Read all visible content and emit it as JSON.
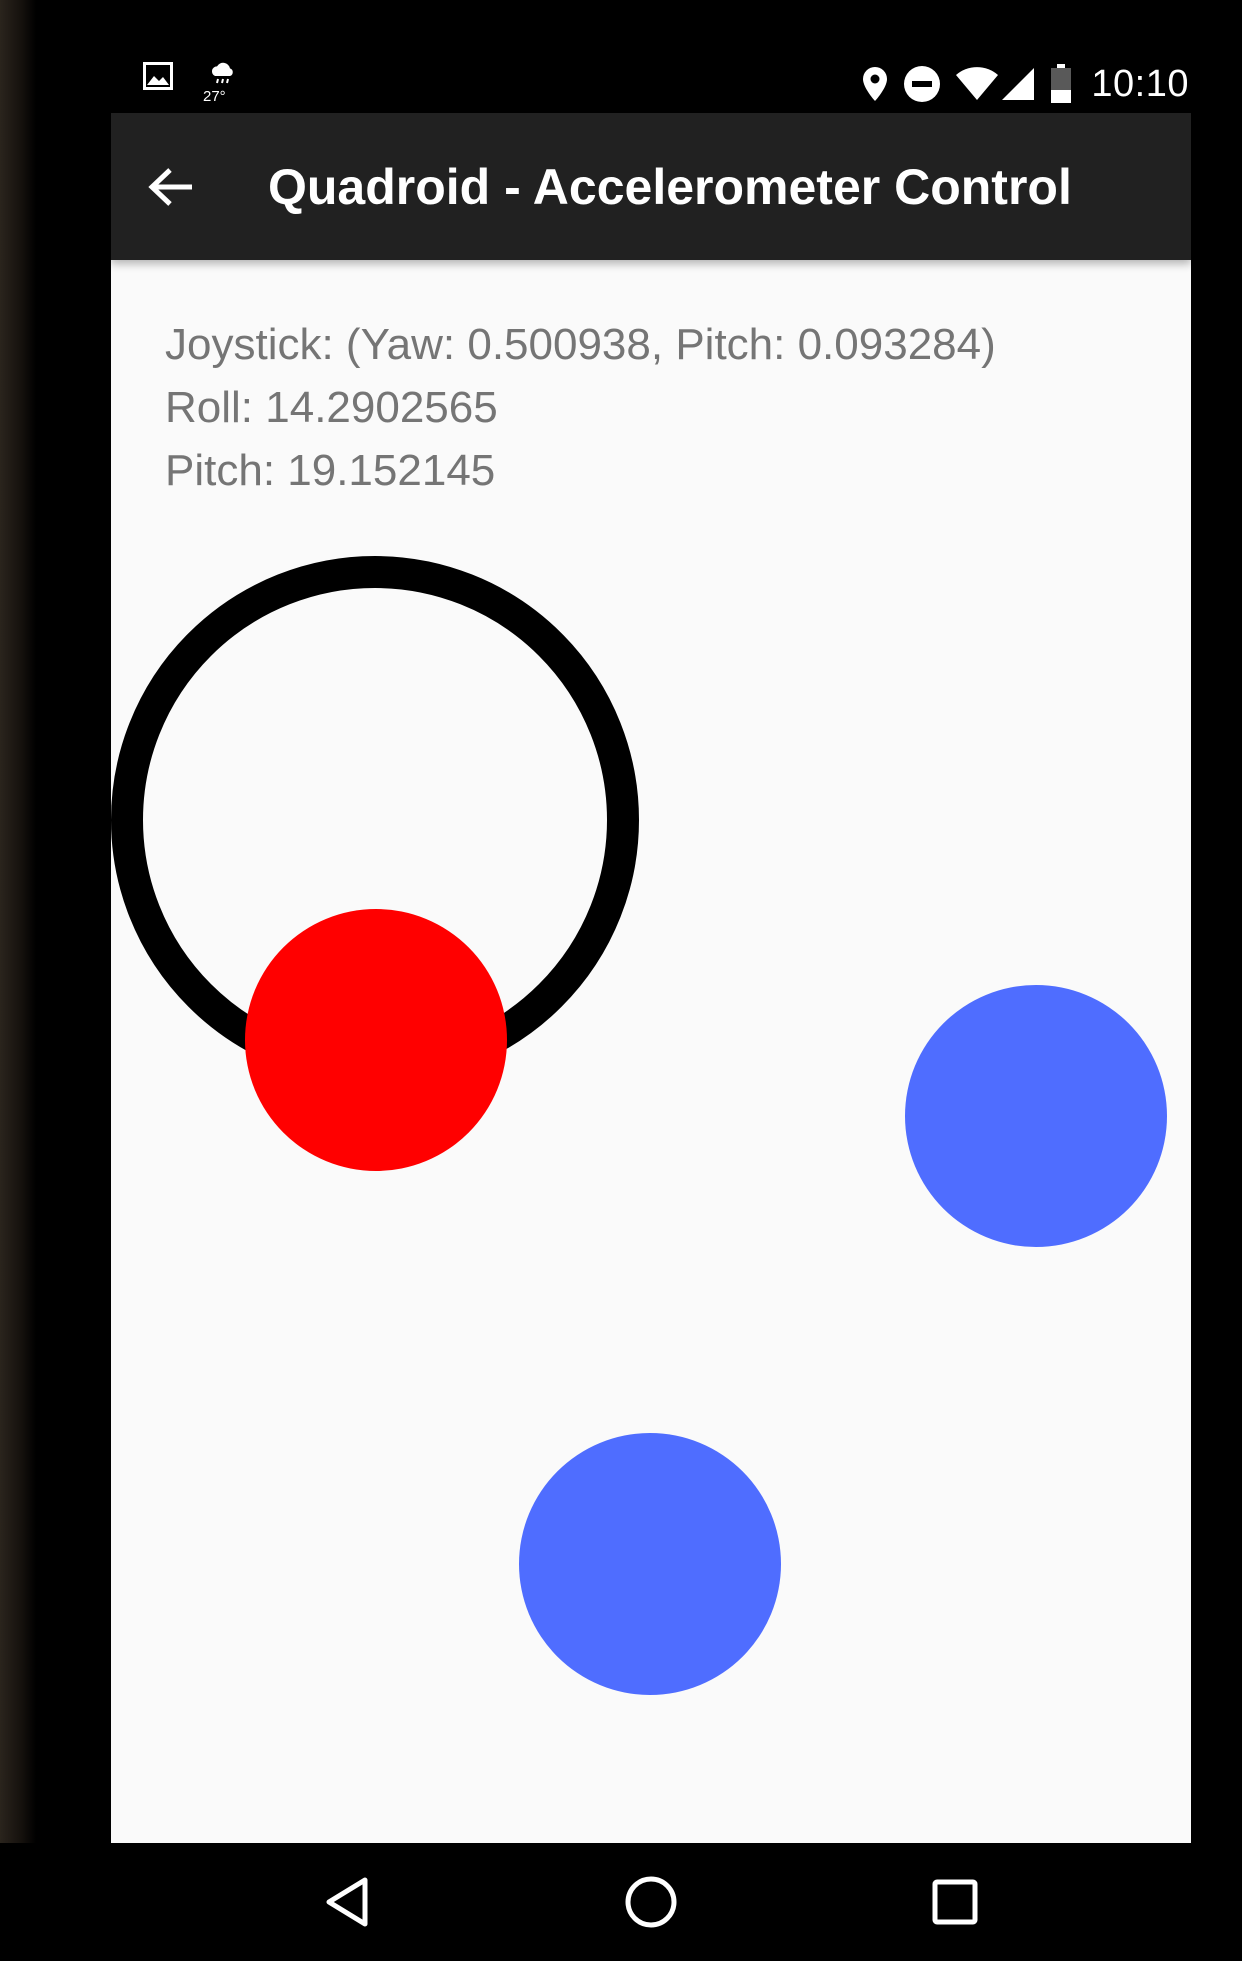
{
  "status_bar": {
    "time": "10:10",
    "weather_temp": "27°",
    "left_icons": [
      "image-icon",
      "weather-icon"
    ],
    "right_icons": [
      "location-icon",
      "do-not-disturb-icon",
      "wifi-icon",
      "cell-signal-icon",
      "battery-icon"
    ]
  },
  "toolbar": {
    "title": "Quadroid - Accelerometer Control",
    "back_icon": "arrow-back-icon"
  },
  "readouts": {
    "joystick": "Joystick: (Yaw: 0.500938, Pitch: 0.093284)",
    "roll": "Roll: 14.2902565",
    "pitch": "Pitch: 19.152145"
  },
  "colors": {
    "toolbar_bg": "#212121",
    "content_bg": "#fafafa",
    "readout_text": "#757575",
    "joystick_ring": "#000000",
    "joystick_knob": "#ff0000",
    "button_circle": "#4f6dff"
  },
  "nav_bar": {
    "icons": [
      "nav-back-icon",
      "nav-home-icon",
      "nav-recents-icon"
    ]
  }
}
